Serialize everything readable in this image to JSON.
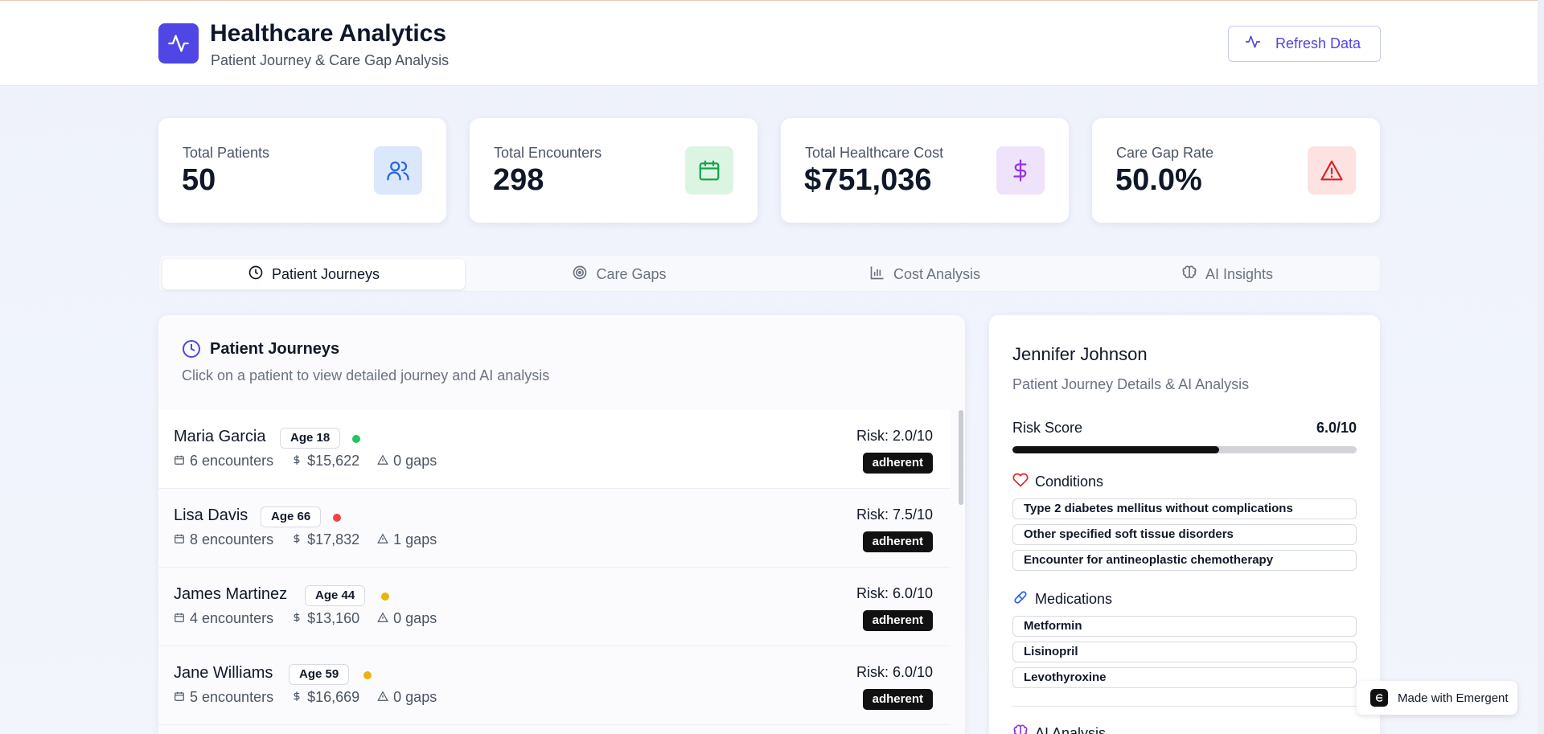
{
  "header": {
    "title": "Healthcare Analytics",
    "subtitle": "Patient Journey & Care Gap Analysis",
    "refresh_label": "Refresh Data"
  },
  "stats": [
    {
      "label": "Total Patients",
      "value": "50",
      "icon": "users-icon",
      "color": "#2563eb",
      "bg": "#dbe7fb"
    },
    {
      "label": "Total Encounters",
      "value": "298",
      "icon": "calendar-icon",
      "color": "#16a34a",
      "bg": "#dcf5e3"
    },
    {
      "label": "Total Healthcare Cost",
      "value": "$751,036",
      "icon": "dollar-icon",
      "color": "#9333ea",
      "bg": "#efe2fb"
    },
    {
      "label": "Care Gap Rate",
      "value": "50.0%",
      "icon": "alert-triangle-icon",
      "color": "#dc2626",
      "bg": "#fde2e2"
    }
  ],
  "tabs": [
    {
      "label": "Patient Journeys",
      "icon": "clock-icon",
      "active": true
    },
    {
      "label": "Care Gaps",
      "icon": "target-icon",
      "active": false
    },
    {
      "label": "Cost Analysis",
      "icon": "bar-chart-icon",
      "active": false
    },
    {
      "label": "AI Insights",
      "icon": "brain-icon",
      "active": false
    }
  ],
  "journeys": {
    "title": "Patient Journeys",
    "subtitle": "Click on a patient to view detailed journey and AI analysis",
    "patients": [
      {
        "name": "Maria Garcia",
        "age": "Age 18",
        "dot": "#22c55e",
        "encounters": "6 encounters",
        "cost": "$15,622",
        "gaps": "0 gaps",
        "risk": "Risk: 2.0/10",
        "status": "adherent"
      },
      {
        "name": "Lisa Davis",
        "age": "Age 66",
        "dot": "#ef4444",
        "encounters": "8 encounters",
        "cost": "$17,832",
        "gaps": "1 gaps",
        "risk": "Risk: 7.5/10",
        "status": "adherent"
      },
      {
        "name": "James Martinez",
        "age": "Age 44",
        "dot": "#eab308",
        "encounters": "4 encounters",
        "cost": "$13,160",
        "gaps": "0 gaps",
        "risk": "Risk: 6.0/10",
        "status": "adherent"
      },
      {
        "name": "Jane Williams",
        "age": "Age 59",
        "dot": "#eab308",
        "encounters": "5 encounters",
        "cost": "$16,669",
        "gaps": "0 gaps",
        "risk": "Risk: 6.0/10",
        "status": "adherent"
      }
    ]
  },
  "detail": {
    "name": "Jennifer Johnson",
    "subtitle": "Patient Journey Details & AI Analysis",
    "risk_label": "Risk Score",
    "risk_value": "6.0/10",
    "risk_fraction": 0.6,
    "conditions_title": "Conditions",
    "conditions": [
      "Type 2 diabetes mellitus without complications",
      "Other specified soft tissue disorders",
      "Encounter for antineoplastic chemotherapy"
    ],
    "medications_title": "Medications",
    "medications": [
      "Metformin",
      "Lisinopril",
      "Levothyroxine"
    ],
    "ai_title": "AI Analysis"
  },
  "badge": {
    "label": "Made with Emergent"
  }
}
